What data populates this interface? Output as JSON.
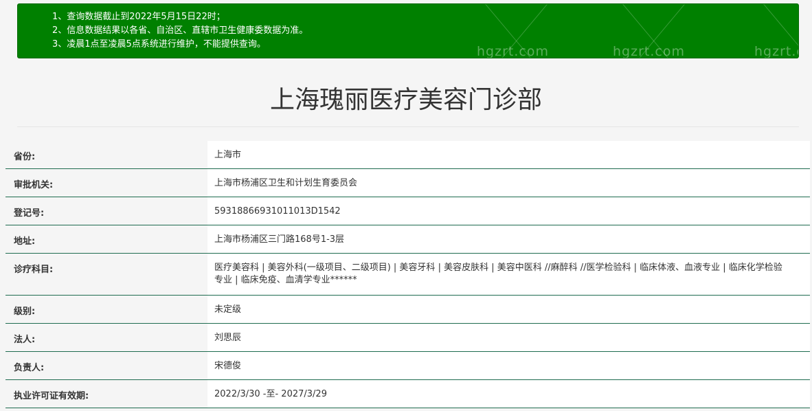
{
  "notice": {
    "lines": [
      "1、查询数据截止到2022年5月15日22时；",
      "2、信息数据结果以各省、自治区、直辖市卫生健康委数据为准。",
      "3、凌晨1点至凌晨5点系统进行维护，不能提供查询。"
    ],
    "watermark": "hgzrt.com",
    "bg_color": "#008000"
  },
  "title": "上海瑰丽医疗美容门诊部",
  "rows": [
    {
      "label": "省份:",
      "value": "上海市"
    },
    {
      "label": "审批机关:",
      "value": "上海市杨浦区卫生和计划生育委员会"
    },
    {
      "label": "登记号:",
      "value": "59318866931011013D1542"
    },
    {
      "label": "地址:",
      "value": "上海市杨浦区三门路168号1-3层"
    },
    {
      "label": "诊疗科目:",
      "value": "医疗美容科 | 美容外科(一级项目、二级项目) | 美容牙科 | 美容皮肤科 | 美容中医科 //麻醉科 //医学检验科 | 临床体液、血液专业 | 临床化学检验专业 | 临床免疫、血清学专业******"
    },
    {
      "label": "级别:",
      "value": "未定级"
    },
    {
      "label": "法人:",
      "value": "刘思辰"
    },
    {
      "label": "负责人:",
      "value": "宋德俊"
    },
    {
      "label": "执业许可证有效期:",
      "value": "2022/3/30 -至- 2027/3/29"
    }
  ],
  "colors": {
    "notice_bg": "#008000",
    "row_border": "#1e6b4f",
    "label_bg": "#f5f5f5",
    "value_bg": "#ffffff"
  }
}
